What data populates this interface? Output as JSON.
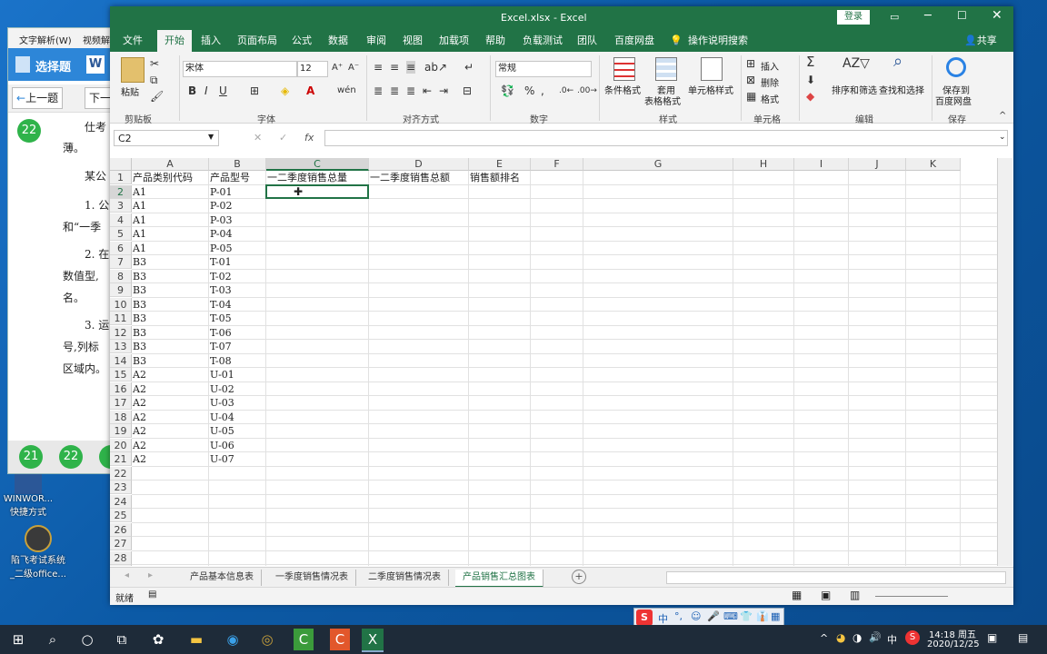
{
  "exam": {
    "menu": [
      "文字解析(W)",
      "视频解"
    ],
    "select_label": "选择题",
    "prev_label": "上一题",
    "next_label": "下一",
    "current_q": "22",
    "text_lines": [
      "仕考",
      "薄。",
      "某公",
      "1. 公",
      "和“一季",
      "2. 在",
      "数值型,",
      "名。",
      "3. 运",
      "号,列标",
      "区域内。"
    ],
    "bottom_q": [
      "21",
      "22",
      "23"
    ]
  },
  "desktop_icons": [
    {
      "label": "WINWOR...",
      "label2": "快捷方式"
    },
    {
      "label": "陷飞考试系统",
      "label2": "_二级office..."
    }
  ],
  "excel": {
    "title": "Excel.xlsx  -  Excel",
    "login_label": "登录",
    "tabs": [
      "文件",
      "开始",
      "插入",
      "页面布局",
      "公式",
      "数据",
      "审阅",
      "视图",
      "加载项",
      "帮助",
      "负载测试",
      "团队",
      "百度网盘"
    ],
    "active_tab": "开始",
    "tell_me": "操作说明搜索",
    "share_label": "共享",
    "font_name": "宋体",
    "font_size": "12",
    "number_format": "常规",
    "paste_label": "粘贴",
    "groups": {
      "clipboard": "剪贴板",
      "font": "字体",
      "align": "对齐方式",
      "number": "数字",
      "styles": "样式",
      "cells": "单元格",
      "edit": "编辑",
      "save": "保存"
    },
    "buttons": {
      "cond_format": "条件格式",
      "table_format_1": "套用",
      "table_format_2": "表格格式",
      "cell_style": "单元格样式",
      "insert": "插入",
      "delete": "删除",
      "format": "格式",
      "sort_filter": "排序和筛选",
      "find_select": "查找和选择",
      "save_baidu_1": "保存到",
      "save_baidu_2": "百度网盘"
    },
    "name_box": "C2",
    "fx_label": "fx",
    "formula": "",
    "columns": [
      "A",
      "B",
      "C",
      "D",
      "E",
      "F",
      "G",
      "H",
      "I",
      "J",
      "K"
    ],
    "rows": [
      [
        "产品类别代码",
        "产品型号",
        "一二季度销售总量",
        "一二季度销售总额",
        "销售额排名"
      ],
      [
        "A1",
        "P-01"
      ],
      [
        "A1",
        "P-02"
      ],
      [
        "A1",
        "P-03"
      ],
      [
        "A1",
        "P-04"
      ],
      [
        "A1",
        "P-05"
      ],
      [
        "B3",
        "T-01"
      ],
      [
        "B3",
        "T-02"
      ],
      [
        "B3",
        "T-03"
      ],
      [
        "B3",
        "T-04"
      ],
      [
        "B3",
        "T-05"
      ],
      [
        "B3",
        "T-06"
      ],
      [
        "B3",
        "T-07"
      ],
      [
        "B3",
        "T-08"
      ],
      [
        "A2",
        "U-01"
      ],
      [
        "A2",
        "U-02"
      ],
      [
        "A2",
        "U-03"
      ],
      [
        "A2",
        "U-04"
      ],
      [
        "A2",
        "U-05"
      ],
      [
        "A2",
        "U-06"
      ],
      [
        "A2",
        "U-07"
      ],
      [],
      [],
      [],
      [],
      [],
      [],
      [],
      []
    ],
    "sheet_tabs": [
      "产品基本信息表",
      "一季度销售情况表",
      "二季度销售情况表",
      "产品销售汇总图表"
    ],
    "active_sheet": "产品销售汇总图表",
    "status": "就绪"
  },
  "ime": {
    "label": "中"
  },
  "taskbar": {
    "time": "14:18 周五",
    "date": "2020/12/25",
    "lang": "中"
  },
  "colors": {
    "excel_green": "#217346",
    "select_green": "#2fb34a"
  }
}
